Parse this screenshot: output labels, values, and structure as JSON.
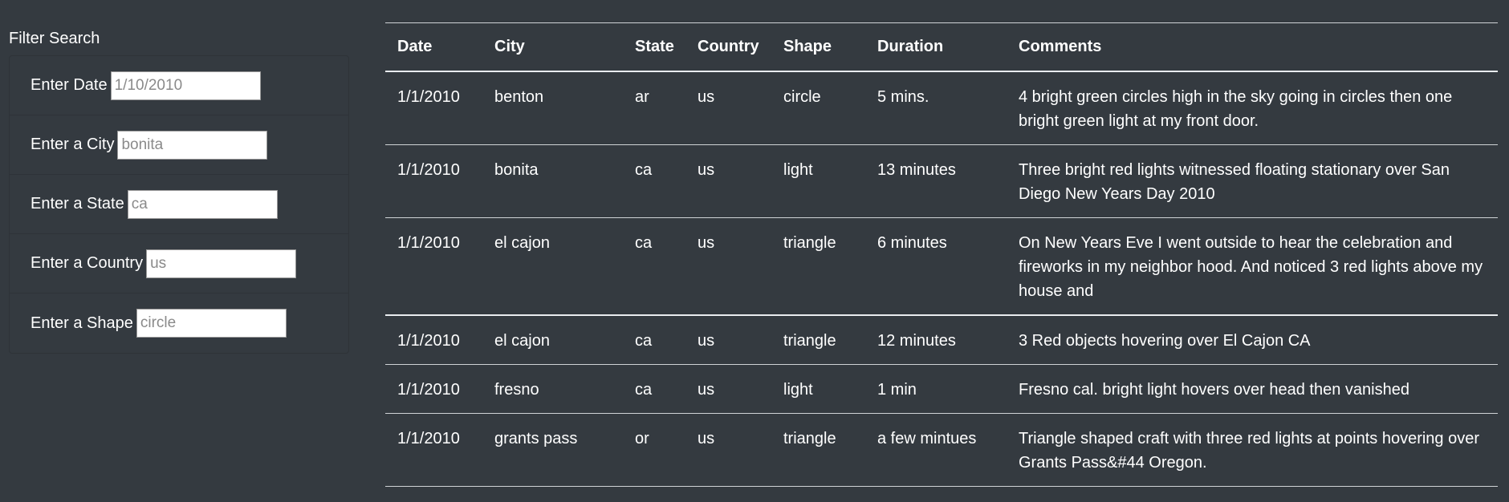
{
  "filters": {
    "title": "Filter Search",
    "items": [
      {
        "label": "Enter Date",
        "placeholder": "1/10/2010",
        "value": ""
      },
      {
        "label": "Enter a City",
        "placeholder": "bonita",
        "value": ""
      },
      {
        "label": "Enter a State",
        "placeholder": "ca",
        "value": ""
      },
      {
        "label": "Enter a Country",
        "placeholder": "us",
        "value": ""
      },
      {
        "label": "Enter a Shape",
        "placeholder": "circle",
        "value": ""
      }
    ]
  },
  "table": {
    "columns": [
      "Date",
      "City",
      "State",
      "Country",
      "Shape",
      "Duration",
      "Comments"
    ],
    "rows": [
      [
        "1/1/2010",
        "benton",
        "ar",
        "us",
        "circle",
        "5 mins.",
        "4 bright green circles high in the sky going in circles then one bright green light at my front door."
      ],
      [
        "1/1/2010",
        "bonita",
        "ca",
        "us",
        "light",
        "13 minutes",
        "Three bright red lights witnessed floating stationary over San Diego New Years Day 2010"
      ],
      [
        "1/1/2010",
        "el cajon",
        "ca",
        "us",
        "triangle",
        "6 minutes",
        "On New Years Eve I went outside to hear the celebration and fireworks in my neighbor hood. And noticed 3 red lights above my house and"
      ],
      [
        "1/1/2010",
        "el cajon",
        "ca",
        "us",
        "triangle",
        "12 minutes",
        "3 Red objects hovering over El Cajon CA"
      ],
      [
        "1/1/2010",
        "fresno",
        "ca",
        "us",
        "light",
        "1 min",
        "Fresno cal. bright light hovers over head then vanished"
      ],
      [
        "1/1/2010",
        "grants pass",
        "or",
        "us",
        "triangle",
        "a few mintues",
        "Triangle shaped craft with three red lights at points hovering over Grants Pass&#44 Oregon."
      ]
    ]
  }
}
